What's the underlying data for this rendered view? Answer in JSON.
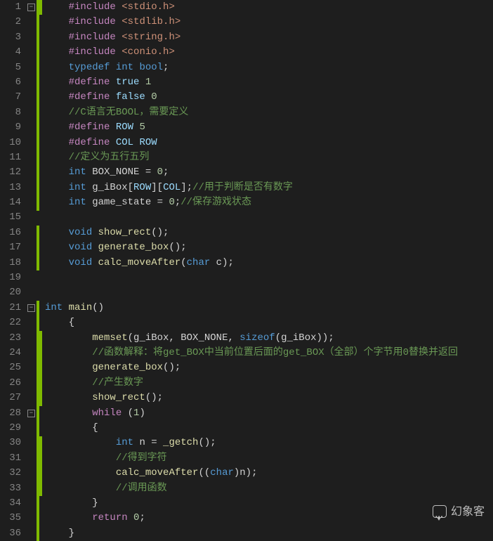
{
  "line_count": 36,
  "fold_markers": [
    {
      "line": 1,
      "symbol": "−"
    },
    {
      "line": 21,
      "symbol": "−"
    },
    {
      "line": 28,
      "symbol": "−"
    }
  ],
  "mod_bars_outer": [
    [
      1,
      14
    ],
    [
      16,
      18
    ],
    [
      21,
      36
    ]
  ],
  "mod_bars_inner": [
    [
      1,
      1
    ],
    [
      23,
      27
    ],
    [
      30,
      33
    ]
  ],
  "tokens": {
    "l1": [
      [
        "#include ",
        "t-macro"
      ],
      [
        "<stdio.h>",
        "t-string"
      ]
    ],
    "l2": [
      [
        "#include ",
        "t-macro"
      ],
      [
        "<stdlib.h>",
        "t-string"
      ]
    ],
    "l3": [
      [
        "#include ",
        "t-macro"
      ],
      [
        "<string.h>",
        "t-string"
      ]
    ],
    "l4": [
      [
        "#include ",
        "t-macro"
      ],
      [
        "<conio.h>",
        "t-string"
      ]
    ],
    "l5": [
      [
        "typedef ",
        "t-type"
      ],
      [
        "int ",
        "t-type"
      ],
      [
        "bool",
        "t-type"
      ],
      [
        ";",
        "t-default"
      ]
    ],
    "l6": [
      [
        "#define ",
        "t-macro"
      ],
      [
        "true ",
        "t-preproc"
      ],
      [
        "1",
        "t-num"
      ]
    ],
    "l7": [
      [
        "#define ",
        "t-macro"
      ],
      [
        "false ",
        "t-preproc"
      ],
      [
        "0",
        "t-num"
      ]
    ],
    "l8": [
      [
        "//C语言无BOOL，需要定义",
        "t-comment"
      ]
    ],
    "l9": [
      [
        "#define ",
        "t-macro"
      ],
      [
        "ROW ",
        "t-preproc"
      ],
      [
        "5",
        "t-num"
      ]
    ],
    "l10": [
      [
        "#define ",
        "t-macro"
      ],
      [
        "COL ",
        "t-preproc"
      ],
      [
        "ROW",
        "t-preproc"
      ]
    ],
    "l11": [
      [
        "//定义为五行五列",
        "t-comment"
      ]
    ],
    "l12": [
      [
        "int ",
        "t-type"
      ],
      [
        "BOX_NONE = ",
        "t-default"
      ],
      [
        "0",
        "t-num"
      ],
      [
        ";",
        "t-default"
      ]
    ],
    "l13": [
      [
        "int ",
        "t-type"
      ],
      [
        "g_iBox[",
        "t-default"
      ],
      [
        "ROW",
        "t-preproc"
      ],
      [
        "][",
        "t-default"
      ],
      [
        "COL",
        "t-preproc"
      ],
      [
        "];",
        "t-default"
      ],
      [
        "//用于判断是否有数字",
        "t-comment"
      ]
    ],
    "l14": [
      [
        "int ",
        "t-type"
      ],
      [
        "game_state = ",
        "t-default"
      ],
      [
        "0",
        "t-num"
      ],
      [
        ";",
        "t-default"
      ],
      [
        "//保存游戏状态",
        "t-comment"
      ]
    ],
    "l15": [],
    "l16": [
      [
        "void ",
        "t-type"
      ],
      [
        "show_rect",
        "t-func"
      ],
      [
        "();",
        "t-default"
      ]
    ],
    "l17": [
      [
        "void ",
        "t-type"
      ],
      [
        "generate_box",
        "t-func"
      ],
      [
        "();",
        "t-default"
      ]
    ],
    "l18": [
      [
        "void ",
        "t-type"
      ],
      [
        "calc_moveAfter",
        "t-func"
      ],
      [
        "(",
        "t-default"
      ],
      [
        "char ",
        "t-type"
      ],
      [
        "c);",
        "t-default"
      ]
    ],
    "l19": [],
    "l20": [],
    "l21": [
      [
        "int ",
        "t-type"
      ],
      [
        "main",
        "t-func"
      ],
      [
        "()",
        "t-default"
      ]
    ],
    "l22": [
      [
        "{",
        "t-default"
      ]
    ],
    "l23": [
      [
        "memset",
        "t-func"
      ],
      [
        "(g_iBox, BOX_NONE, ",
        "t-default"
      ],
      [
        "sizeof",
        "t-type"
      ],
      [
        "(g_iBox));",
        "t-default"
      ]
    ],
    "l24": [
      [
        "//函数解释：将get_BOX中当前位置后面的get_BOX（全部）个字节用0替换并返回",
        "t-comment"
      ]
    ],
    "l25": [
      [
        "generate_box",
        "t-func"
      ],
      [
        "();",
        "t-default"
      ]
    ],
    "l26": [
      [
        "//产生数字",
        "t-comment"
      ]
    ],
    "l27": [
      [
        "show_rect",
        "t-func"
      ],
      [
        "();",
        "t-default"
      ]
    ],
    "l28": [
      [
        "while ",
        "t-keyword"
      ],
      [
        "(",
        "t-default"
      ],
      [
        "1",
        "t-num"
      ],
      [
        ")",
        "t-default"
      ]
    ],
    "l29": [
      [
        "{",
        "t-default"
      ]
    ],
    "l30": [
      [
        "int ",
        "t-type"
      ],
      [
        "n = ",
        "t-default"
      ],
      [
        "_getch",
        "t-func"
      ],
      [
        "();",
        "t-default"
      ]
    ],
    "l31": [
      [
        "//得到字符",
        "t-comment"
      ]
    ],
    "l32": [
      [
        "calc_moveAfter",
        "t-func"
      ],
      [
        "((",
        "t-default"
      ],
      [
        "char",
        "t-type"
      ],
      [
        ")n);",
        "t-default"
      ]
    ],
    "l33": [
      [
        "//调用函数",
        "t-comment"
      ]
    ],
    "l34": [
      [
        "}",
        "t-default"
      ]
    ],
    "l35": [
      [
        "return ",
        "t-keyword"
      ],
      [
        "0",
        "t-num"
      ],
      [
        ";",
        "t-default"
      ]
    ],
    "l36": [
      [
        "}",
        "t-default"
      ]
    ]
  },
  "indents": {
    "l1": 1,
    "l2": 1,
    "l3": 1,
    "l4": 1,
    "l5": 1,
    "l6": 1,
    "l7": 1,
    "l8": 1,
    "l9": 1,
    "l10": 1,
    "l11": 1,
    "l12": 1,
    "l13": 1,
    "l14": 1,
    "l15": 0,
    "l16": 1,
    "l17": 1,
    "l18": 1,
    "l19": 0,
    "l20": 0,
    "l21": 0,
    "l22": 1,
    "l23": 2,
    "l24": 2,
    "l25": 2,
    "l26": 2,
    "l27": 2,
    "l28": 2,
    "l29": 2,
    "l30": 3,
    "l31": 3,
    "l32": 3,
    "l33": 3,
    "l34": 2,
    "l35": 2,
    "l36": 1
  },
  "watermark": "幻象客"
}
